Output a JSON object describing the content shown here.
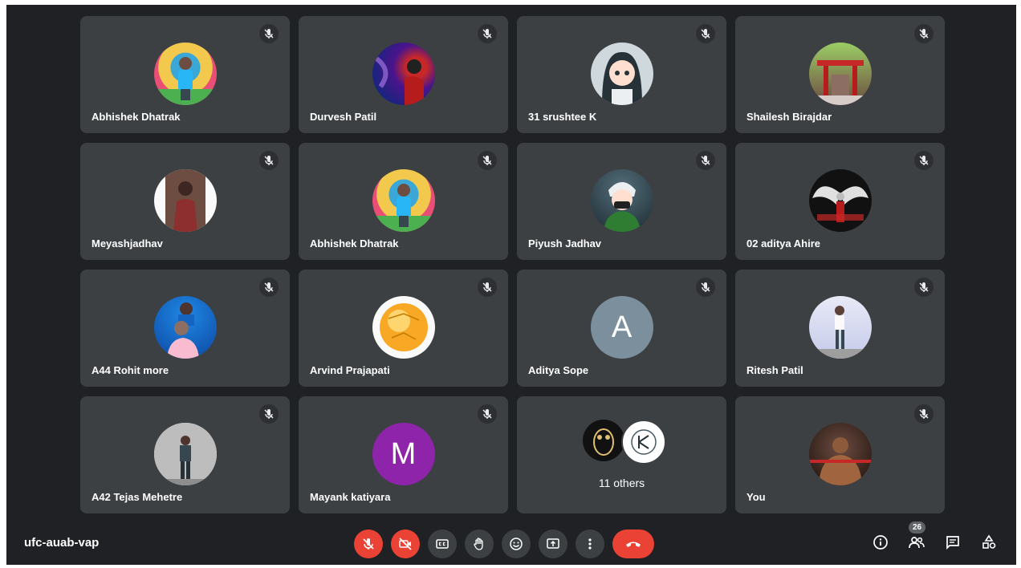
{
  "meeting": {
    "code": "ufc-auab-vap"
  },
  "participants": [
    {
      "name": "Abhishek Dhatrak"
    },
    {
      "name": "Durvesh Patil"
    },
    {
      "name": "31 srushtee K"
    },
    {
      "name": "Shailesh Birajdar"
    },
    {
      "name": "Meyashjadhav"
    },
    {
      "name": "Abhishek Dhatrak"
    },
    {
      "name": "Piyush Jadhav"
    },
    {
      "name": "02 aditya Ahire"
    },
    {
      "name": "A44 Rohit more"
    },
    {
      "name": "Arvind Prajapati"
    },
    {
      "name": "Aditya Sope",
      "initial": "A"
    },
    {
      "name": "Ritesh Patil"
    },
    {
      "name": "A42 Tejas Mehetre"
    },
    {
      "name": "Mayank katiyara",
      "initial": "M"
    },
    {
      "name": "You"
    }
  ],
  "others_tile": {
    "label": "11 others"
  },
  "toolbar": {
    "people_count": "26"
  },
  "colors": {
    "background": "#202124",
    "tile": "#3c4043",
    "danger": "#ea4335",
    "avatar_a": "#7b8f9c",
    "avatar_m": "#8e24aa"
  }
}
